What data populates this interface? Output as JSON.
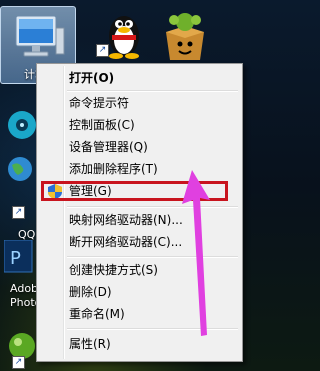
{
  "desktop": {
    "icons": [
      {
        "name": "computer",
        "label": "计算"
      },
      {
        "name": "qq",
        "label": "QQ"
      },
      {
        "name": "adobe-photoshop",
        "label": "Adob Photo"
      }
    ]
  },
  "context_menu": {
    "items": [
      {
        "label": "打开(O)",
        "bold": true
      },
      {
        "label": "命令提示符"
      },
      {
        "label": "控制面板(C)"
      },
      {
        "label": "设备管理器(Q)"
      },
      {
        "label": "添加删除程序(T)"
      },
      {
        "label": "管理(G)",
        "highlighted": true
      },
      {
        "label": "映射网络驱动器(N)..."
      },
      {
        "label": "断开网络驱动器(C)..."
      },
      {
        "label": "创建快捷方式(S)"
      },
      {
        "label": "删除(D)"
      },
      {
        "label": "重命名(M)"
      },
      {
        "label": "属性(R)"
      }
    ]
  },
  "colors": {
    "highlight_border": "#c8141e",
    "arrow": "#e040e0"
  }
}
